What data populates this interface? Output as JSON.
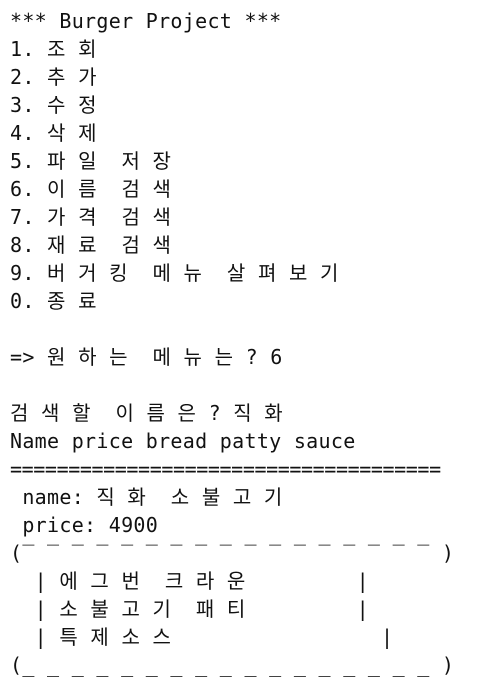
{
  "terminal": {
    "header": "*** Burger Project ***",
    "menu": [
      "1. 조 회",
      "2. 추 가",
      "3. 수 정",
      "4. 삭 제",
      "5. 파 일  저 장",
      "6. 이 름  검 색",
      "7. 가 격  검 색",
      "8. 재 료  검 색",
      "9. 버 거 킹  메 뉴  살 펴 보 기",
      "0. 종 료"
    ],
    "prompt": "=> 원 하 는  메 뉴 는 ? 6",
    "search_prompt": "검 색 할  이 름 은 ? 직 화",
    "columns_header": "Name price bread patty sauce",
    "separator": "=====================================",
    "result": {
      "name_line": " name: 직 화  소 불 고 기",
      "price_line": " price: 4900",
      "box_top": "(‾ ‾ ‾ ‾ ‾ ‾ ‾ ‾ ‾ ‾ ‾ ‾ ‾ ‾ ‾ ‾ ‾ )",
      "box_rows": [
        "  | 에 그 번  크 라 운         |",
        "  | 소 불 고 기  패 티         |",
        "  | 특 제 소 스                 |"
      ],
      "box_bottom": "(_ _ _ _ _ _ _ _ _ _ _ _ _ _ _ _ _ )"
    }
  }
}
